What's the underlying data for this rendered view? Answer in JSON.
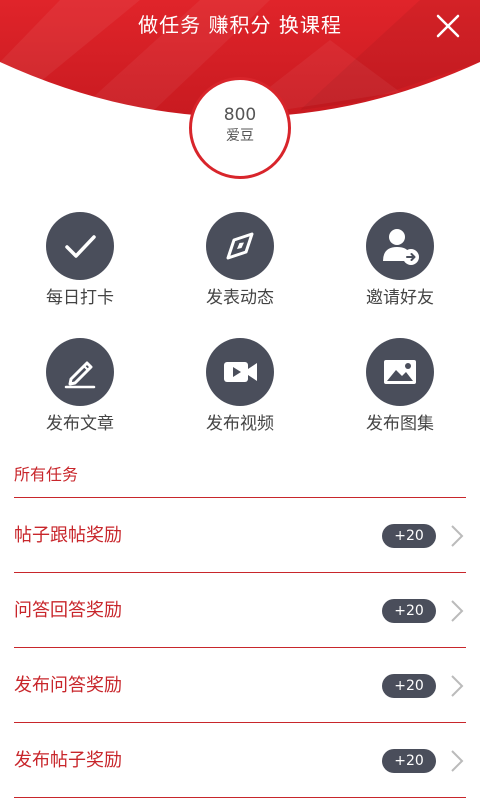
{
  "header": {
    "title": "做任务 赚积分 换课程",
    "close_icon": "close-icon"
  },
  "points": {
    "value": "800",
    "unit": "爱豆"
  },
  "actions": [
    {
      "label": "每日打卡",
      "icon": "checkmark-icon"
    },
    {
      "label": "发表动态",
      "icon": "compass-icon"
    },
    {
      "label": "邀请好友",
      "icon": "invite-user-icon"
    },
    {
      "label": "发布文章",
      "icon": "pencil-icon"
    },
    {
      "label": "发布视频",
      "icon": "video-camera-icon"
    },
    {
      "label": "发布图集",
      "icon": "image-gallery-icon"
    }
  ],
  "tasks": {
    "section_title": "所有任务",
    "items": [
      {
        "label": "帖子跟帖奖励",
        "reward": "+20"
      },
      {
        "label": "问答回答奖励",
        "reward": "+20"
      },
      {
        "label": "发布问答奖励",
        "reward": "+20"
      },
      {
        "label": "发布帖子奖励",
        "reward": "+20"
      }
    ]
  },
  "colors": {
    "brand_red": "#d8252b",
    "text_red": "#c8262b",
    "icon_dark": "#4a4e5b"
  }
}
